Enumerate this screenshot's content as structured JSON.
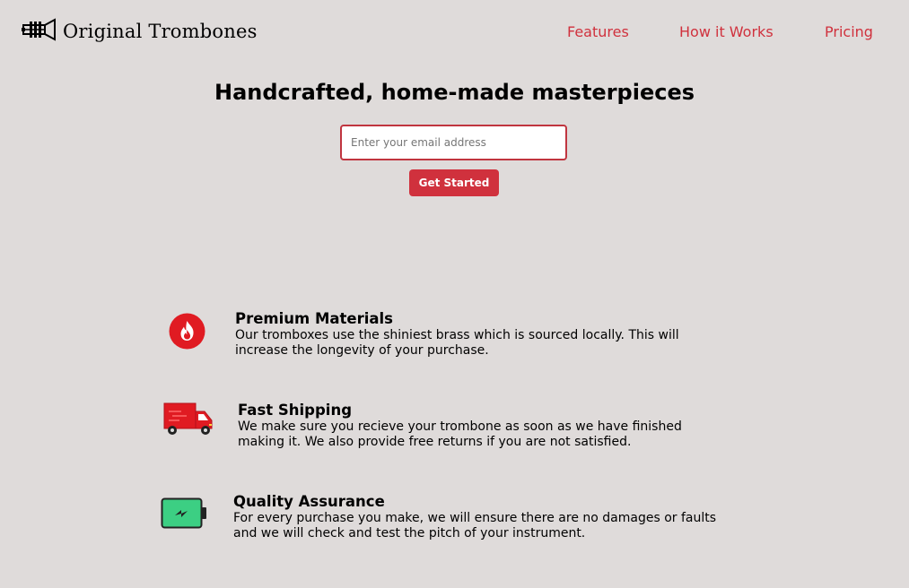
{
  "header": {
    "logo_text": "Original Trombones",
    "logo_icon": "trombone-logo-icon",
    "nav": [
      {
        "label": "Features"
      },
      {
        "label": "How it Works"
      },
      {
        "label": "Pricing"
      }
    ],
    "nav_color": "#d0313d"
  },
  "hero": {
    "title": "Handcrafted, home-made masterpieces",
    "email_placeholder": "Enter your email address",
    "email_value": "",
    "cta_label": "Get Started"
  },
  "features": [
    {
      "icon": "fire-icon",
      "title": "Premium Materials",
      "description": "Our tromboxes use the shiniest brass which is sourced locally. This will increase the longevity of your purchase."
    },
    {
      "icon": "truck-icon",
      "title": "Fast Shipping",
      "description": "We make sure you recieve your trombone as soon as we have finished making it. We also provide free returns if you are not satisfied."
    },
    {
      "icon": "battery-charging-icon",
      "title": "Quality Assurance",
      "description": "For every purchase you make, we will ensure there are no damages or faults and we will check and test the pitch of your instrument."
    }
  ],
  "colors": {
    "background": "#dfdbda",
    "accent": "#d0313d",
    "battery_green": "#3ccf83"
  }
}
